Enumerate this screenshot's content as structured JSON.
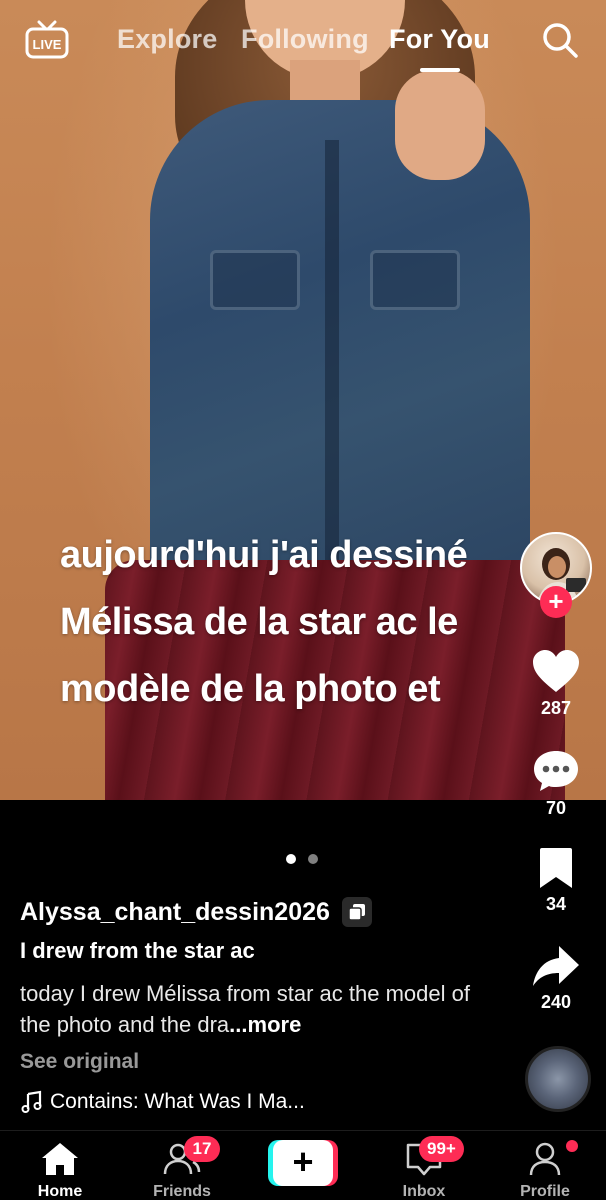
{
  "top_nav": {
    "live_label": "LIVE",
    "tabs": [
      {
        "label": "Explore",
        "active": false
      },
      {
        "label": "Following",
        "active": false
      },
      {
        "label": "For You",
        "active": true
      }
    ]
  },
  "overlay_caption": {
    "lines": [
      "aujourd'hui j'ai dessiné",
      "Mélissa de la star ac le",
      "modèle de la photo et"
    ]
  },
  "actions": {
    "likes": "287",
    "comments": "70",
    "saves": "34",
    "shares": "240",
    "follow_symbol": "+"
  },
  "post": {
    "username": "Alyssa_chant_dessin2026",
    "title": "I drew from the star ac",
    "description": "today I drew Mélissa from star ac the model of the photo and the dra",
    "more_label": "...more",
    "see_original": "See original",
    "music": "Contains: What Was I Ma..."
  },
  "slides": {
    "count": 2,
    "active_index": 0
  },
  "bottom_nav": {
    "items": [
      {
        "label": "Home",
        "active": true
      },
      {
        "label": "Friends",
        "badge": "17"
      },
      {
        "label": "Inbox",
        "badge": "99+"
      },
      {
        "label": "Profile",
        "dot": true
      }
    ],
    "create_symbol": "+"
  },
  "colors": {
    "accent_red": "#fe2c55",
    "accent_cyan": "#25f4ee",
    "background": "#000000"
  }
}
